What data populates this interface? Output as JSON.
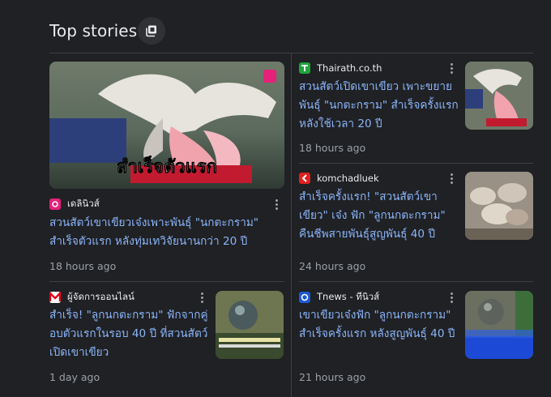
{
  "header": {
    "title": "Top stories"
  },
  "stories": [
    {
      "source": "เดลินิวส์",
      "headline": "สวนสัตว์เขาเขียวเจ๋งเพาะพันธุ์ \"นกตะกราม\" สำเร็จตัวแรก หลังทุ่มเทวิจัยนานกว่า 20 ปี",
      "time": "18 hours ago",
      "image_caption": "สำเร็จตัวแรก",
      "logo_color": "#e6217a"
    },
    {
      "source": "ผู้จัดการออนไลน์",
      "headline": "สำเร็จ! \"ลูกนกตะกราม\" ฟักจากคู่อบตัวแรกในรอบ 40 ปี ที่สวนสัตว์เปิดเขาเขียว",
      "time": "1 day ago",
      "logo_color": "#e0001b"
    },
    {
      "source": "Thairath.co.th",
      "headline": "สวนสัตว์เปิดเขาเขียว เพาะขยายพันธุ์ \"นกตะกราม\" สำเร็จครั้งแรก หลังใช้เวลา 20 ปี",
      "time": "18 hours ago",
      "logo_color": "#1fa33a"
    },
    {
      "source": "komchadluek",
      "headline": "สำเร็จครั้งแรก! \"สวนสัตว์เขาเขียว\" เจ๋ง ฟัก \"ลูกนกตะกราม\" คืนชีพสายพันธุ์สูญพันธุ์ 40 ปี",
      "time": "24 hours ago",
      "logo_color": "#e0201e"
    },
    {
      "source": "Tnews - ทีนิวส์",
      "headline": "เขาเขียวเจ๋งฟัก \"ลูกนกตะกราม\" สำเร็จครั้งแรก หลังสูญพันธุ์ 40 ปี",
      "time": "21 hours ago",
      "logo_color": "#1b59d6"
    }
  ]
}
